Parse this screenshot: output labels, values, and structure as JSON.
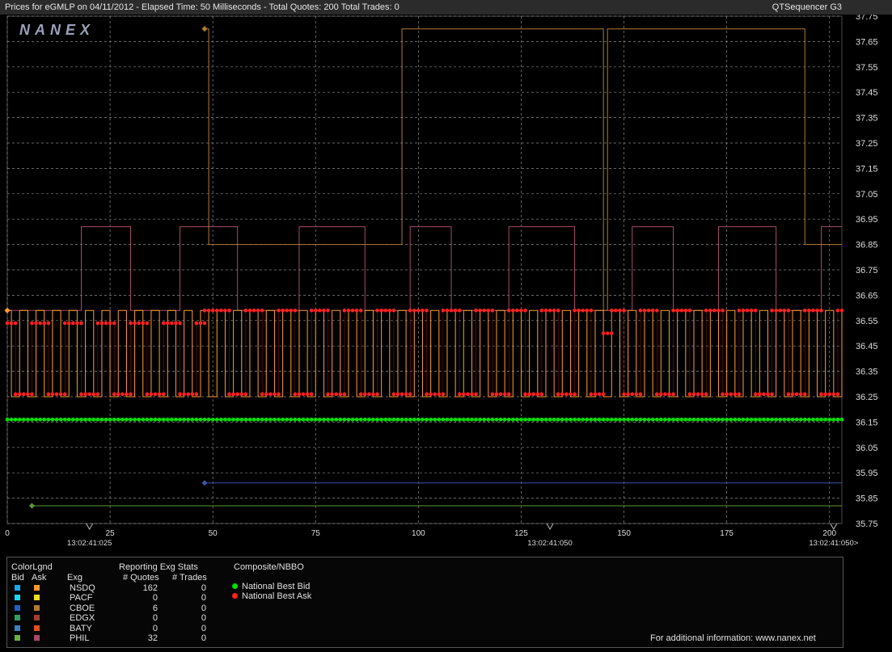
{
  "header": {
    "title": "Prices for  eGMLP  on  04/11/2012  -  Elapsed Time: 50 Milliseconds  -  Total Quotes: 200  Total Trades: 0",
    "product": "QTSequencer G3"
  },
  "logo_text": "NANEX",
  "colors": {
    "background": "#000000",
    "grid": "#8a8a8a",
    "nbbo_bid": "#00e000",
    "nbbo_ask": "#ff2020",
    "nsdq_ask": "#ff9b2e",
    "cboe_ask": "#b07a30",
    "phil_ask": "#a84a6a",
    "cboe_bid": "#3a55a8",
    "phil_bid": "#5a9a3a"
  },
  "chart_data": {
    "type": "line",
    "title": "",
    "x_range": [
      0,
      203
    ],
    "y_range": [
      35.75,
      37.75
    ],
    "y_ticks": [
      "35.75",
      "35.85",
      "35.95",
      "36.05",
      "36.15",
      "36.25",
      "36.35",
      "36.45",
      "36.55",
      "36.65",
      "36.75",
      "36.85",
      "36.95",
      "37.05",
      "37.15",
      "37.25",
      "37.35",
      "37.45",
      "37.55",
      "37.65",
      "37.75"
    ],
    "x_ticks": [
      "0",
      "25",
      "50",
      "75",
      "100",
      "125",
      "150",
      "175",
      "200"
    ],
    "time_labels": [
      {
        "x": 20,
        "label": "13:02:41:025"
      },
      {
        "x": 132,
        "label": "13:02:41:050"
      },
      {
        "x": 201,
        "label": "13:02:41:050>"
      }
    ],
    "grid": true,
    "series": [
      {
        "name": "National Best Bid",
        "step": false,
        "points": [
          [
            0,
            36.16
          ],
          [
            203,
            36.16
          ]
        ]
      },
      {
        "name": "National Best Ask",
        "step": true,
        "points": [
          [
            0,
            36.54
          ],
          [
            2,
            36.26
          ],
          [
            6,
            36.54
          ],
          [
            10,
            36.26
          ],
          [
            14,
            36.54
          ],
          [
            18,
            36.26
          ],
          [
            22,
            36.54
          ],
          [
            26,
            36.26
          ],
          [
            30,
            36.54
          ],
          [
            34,
            36.26
          ],
          [
            38,
            36.54
          ],
          [
            42,
            36.26
          ],
          [
            46,
            36.54
          ],
          [
            48,
            36.59
          ],
          [
            54,
            36.26
          ],
          [
            58,
            36.59
          ],
          [
            62,
            36.26
          ],
          [
            66,
            36.59
          ],
          [
            70,
            36.26
          ],
          [
            74,
            36.59
          ],
          [
            78,
            36.26
          ],
          [
            82,
            36.59
          ],
          [
            86,
            36.26
          ],
          [
            90,
            36.59
          ],
          [
            94,
            36.26
          ],
          [
            98,
            36.59
          ],
          [
            102,
            36.26
          ],
          [
            106,
            36.59
          ],
          [
            110,
            36.26
          ],
          [
            114,
            36.59
          ],
          [
            118,
            36.26
          ],
          [
            122,
            36.59
          ],
          [
            126,
            36.26
          ],
          [
            130,
            36.59
          ],
          [
            134,
            36.26
          ],
          [
            138,
            36.59
          ],
          [
            142,
            36.26
          ],
          [
            145,
            36.5
          ],
          [
            147,
            36.59
          ],
          [
            150,
            36.26
          ],
          [
            154,
            36.59
          ],
          [
            158,
            36.26
          ],
          [
            162,
            36.59
          ],
          [
            166,
            36.26
          ],
          [
            170,
            36.59
          ],
          [
            174,
            36.26
          ],
          [
            178,
            36.59
          ],
          [
            182,
            36.26
          ],
          [
            186,
            36.59
          ],
          [
            190,
            36.26
          ],
          [
            194,
            36.59
          ],
          [
            198,
            36.26
          ],
          [
            202,
            36.59
          ]
        ]
      },
      {
        "name": "NSDQ Ask",
        "step": true,
        "points": [
          [
            0,
            36.59
          ],
          [
            1,
            36.25
          ],
          [
            3,
            36.59
          ],
          [
            5,
            36.25
          ],
          [
            7,
            36.59
          ],
          [
            9,
            36.25
          ],
          [
            11,
            36.59
          ],
          [
            13,
            36.25
          ],
          [
            15,
            36.59
          ],
          [
            17,
            36.25
          ],
          [
            19,
            36.59
          ],
          [
            21,
            36.25
          ],
          [
            23,
            36.59
          ],
          [
            25,
            36.25
          ],
          [
            27,
            36.59
          ],
          [
            29,
            36.25
          ],
          [
            31,
            36.59
          ],
          [
            33,
            36.25
          ],
          [
            35,
            36.59
          ],
          [
            37,
            36.25
          ],
          [
            39,
            36.59
          ],
          [
            41,
            36.25
          ],
          [
            43,
            36.59
          ],
          [
            45,
            36.25
          ],
          [
            47,
            36.59
          ],
          [
            49,
            36.25
          ],
          [
            51,
            36.59
          ],
          [
            53,
            36.25
          ],
          [
            55,
            36.59
          ],
          [
            57,
            36.25
          ],
          [
            59,
            36.59
          ],
          [
            61,
            36.25
          ],
          [
            63,
            36.59
          ],
          [
            65,
            36.25
          ],
          [
            67,
            36.59
          ],
          [
            69,
            36.25
          ],
          [
            71,
            36.59
          ],
          [
            73,
            36.25
          ],
          [
            75,
            36.59
          ],
          [
            77,
            36.25
          ],
          [
            79,
            36.59
          ],
          [
            81,
            36.25
          ],
          [
            83,
            36.59
          ],
          [
            85,
            36.25
          ],
          [
            87,
            36.59
          ],
          [
            89,
            36.25
          ],
          [
            91,
            36.59
          ],
          [
            93,
            36.25
          ],
          [
            95,
            36.59
          ],
          [
            97,
            36.25
          ],
          [
            99,
            36.59
          ],
          [
            101,
            36.25
          ],
          [
            103,
            36.59
          ],
          [
            105,
            36.25
          ],
          [
            107,
            36.59
          ],
          [
            109,
            36.25
          ],
          [
            111,
            36.59
          ],
          [
            113,
            36.25
          ],
          [
            115,
            36.59
          ],
          [
            117,
            36.25
          ],
          [
            119,
            36.59
          ],
          [
            121,
            36.25
          ],
          [
            123,
            36.59
          ],
          [
            125,
            36.25
          ],
          [
            127,
            36.59
          ],
          [
            129,
            36.25
          ],
          [
            131,
            36.59
          ],
          [
            133,
            36.25
          ],
          [
            135,
            36.59
          ],
          [
            137,
            36.25
          ],
          [
            139,
            36.59
          ],
          [
            141,
            36.25
          ],
          [
            143,
            36.59
          ],
          [
            145,
            36.25
          ],
          [
            147,
            36.59
          ],
          [
            149,
            36.25
          ],
          [
            151,
            36.59
          ],
          [
            153,
            36.25
          ],
          [
            155,
            36.59
          ],
          [
            157,
            36.25
          ],
          [
            159,
            36.59
          ],
          [
            161,
            36.25
          ],
          [
            163,
            36.59
          ],
          [
            165,
            36.25
          ],
          [
            167,
            36.59
          ],
          [
            169,
            36.25
          ],
          [
            171,
            36.59
          ],
          [
            173,
            36.25
          ],
          [
            175,
            36.59
          ],
          [
            177,
            36.25
          ],
          [
            179,
            36.59
          ],
          [
            181,
            36.25
          ],
          [
            183,
            36.59
          ],
          [
            185,
            36.25
          ],
          [
            187,
            36.59
          ],
          [
            189,
            36.25
          ],
          [
            191,
            36.59
          ],
          [
            193,
            36.25
          ],
          [
            195,
            36.59
          ],
          [
            197,
            36.25
          ],
          [
            199,
            36.59
          ],
          [
            201,
            36.25
          ],
          [
            203,
            36.59
          ]
        ]
      },
      {
        "name": "CBOE Ask",
        "step": true,
        "points": [
          [
            48,
            37.7
          ],
          [
            49,
            36.85
          ],
          [
            96,
            36.85
          ],
          [
            96,
            37.7
          ],
          [
            145,
            37.7
          ],
          [
            145,
            36.59
          ],
          [
            146,
            36.59
          ],
          [
            146,
            37.7
          ],
          [
            194,
            37.7
          ],
          [
            194,
            36.85
          ],
          [
            203,
            36.85
          ]
        ]
      },
      {
        "name": "PHIL Ask",
        "step": true,
        "points": [
          [
            0,
            36.59
          ],
          [
            18,
            36.59
          ],
          [
            18,
            36.92
          ],
          [
            30,
            36.92
          ],
          [
            30,
            36.59
          ],
          [
            42,
            36.59
          ],
          [
            42,
            36.92
          ],
          [
            56,
            36.92
          ],
          [
            56,
            36.59
          ],
          [
            71,
            36.59
          ],
          [
            71,
            36.92
          ],
          [
            87,
            36.92
          ],
          [
            87,
            36.59
          ],
          [
            98,
            36.59
          ],
          [
            98,
            36.92
          ],
          [
            108,
            36.92
          ],
          [
            108,
            36.59
          ],
          [
            122,
            36.59
          ],
          [
            122,
            36.92
          ],
          [
            138,
            36.92
          ],
          [
            138,
            36.59
          ],
          [
            152,
            36.59
          ],
          [
            152,
            36.92
          ],
          [
            162,
            36.92
          ],
          [
            162,
            36.59
          ],
          [
            173,
            36.59
          ],
          [
            173,
            36.92
          ],
          [
            187,
            36.92
          ],
          [
            187,
            36.59
          ],
          [
            198,
            36.59
          ],
          [
            198,
            36.92
          ],
          [
            203,
            36.92
          ]
        ]
      },
      {
        "name": "CBOE Bid",
        "step": false,
        "points": [
          [
            48,
            35.91
          ],
          [
            203,
            35.91
          ]
        ]
      },
      {
        "name": "PHIL Bid",
        "step": false,
        "points": [
          [
            6,
            35.82
          ],
          [
            203,
            35.82
          ]
        ]
      }
    ]
  },
  "legend": {
    "color_legend_title": "ColorLgnd",
    "bid_header": "Bid",
    "ask_header": "Ask",
    "stats_title": "Reporting Exg Stats",
    "exg_header": "Exg",
    "quotes_header": "# Quotes",
    "trades_header": "# Trades",
    "rows": [
      {
        "exg": "NSDQ",
        "quotes": "162",
        "trades": "0",
        "bid_color": "#18a8e8",
        "ask_color": "#ff9b2e"
      },
      {
        "exg": "PACF",
        "quotes": "0",
        "trades": "0",
        "bid_color": "#18d8f0",
        "ask_color": "#f0e020"
      },
      {
        "exg": "CBOE",
        "quotes": "6",
        "trades": "0",
        "bid_color": "#2060c0",
        "ask_color": "#b07a30"
      },
      {
        "exg": "EDGX",
        "quotes": "0",
        "trades": "0",
        "bid_color": "#30a060",
        "ask_color": "#a04030"
      },
      {
        "exg": "BATY",
        "quotes": "0",
        "trades": "0",
        "bid_color": "#4080c0",
        "ask_color": "#e05020"
      },
      {
        "exg": "PHIL",
        "quotes": "32",
        "trades": "0",
        "bid_color": "#6ab040",
        "ask_color": "#a84a6a"
      }
    ],
    "composite_title": "Composite/NBBO",
    "nbbo_items": [
      {
        "label": "National Best Bid",
        "color": "#00e000"
      },
      {
        "label": "National Best Ask",
        "color": "#ff2020"
      }
    ],
    "footer": "For additional information: www.nanex.net"
  }
}
